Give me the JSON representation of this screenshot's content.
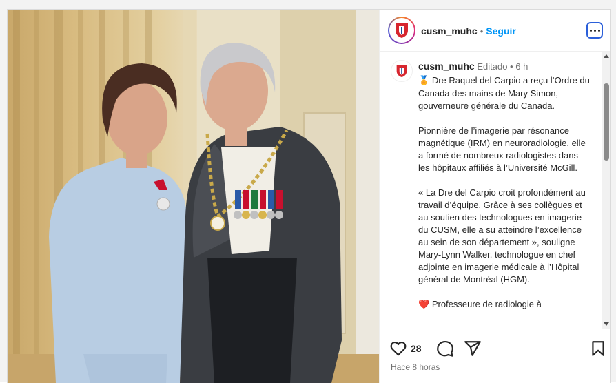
{
  "account": {
    "username": "cusm_muhc",
    "follow_label": "Seguir",
    "separator": "•"
  },
  "caption": {
    "username": "cusm_muhc",
    "edited_label": "Editado",
    "separator": "•",
    "age": "6 h",
    "paragraphs": [
      {
        "emoji": "🏅",
        "text": "Dre Raquel del Carpio a reçu l’Ordre du Canada des mains de Mary Simon, gouverneure générale du Canada."
      },
      {
        "emoji": "",
        "text": "Pionnière de l’imagerie par résonance magnétique (IRM) en neuroradiologie, elle a formé de nombreux radiologistes dans les hôpitaux affiliés à l’Université McGill."
      },
      {
        "emoji": "",
        "text": "« La Dre del Carpio croit profondément au travail d’équipe. Grâce à ses collègues et au soutien des technologues en imagerie du CUSM, elle a su atteindre l’excellence au sein de son département », souligne Mary-Lynn Walker, technologue en chef adjointe en imagerie médicale à l’Hôpital général de Montréal (HGM)."
      },
      {
        "emoji": "❤️",
        "text": "Professeure de radiologie à"
      }
    ]
  },
  "actions": {
    "likes_count": "28",
    "posted_ago": "Hace 8 horas",
    "icons": [
      "heart-icon",
      "comment-icon",
      "share-icon",
      "bookmark-icon"
    ]
  },
  "colors": {
    "follow_blue": "#0095f6",
    "border": "#dbdbdb",
    "muted_text": "#737373"
  }
}
